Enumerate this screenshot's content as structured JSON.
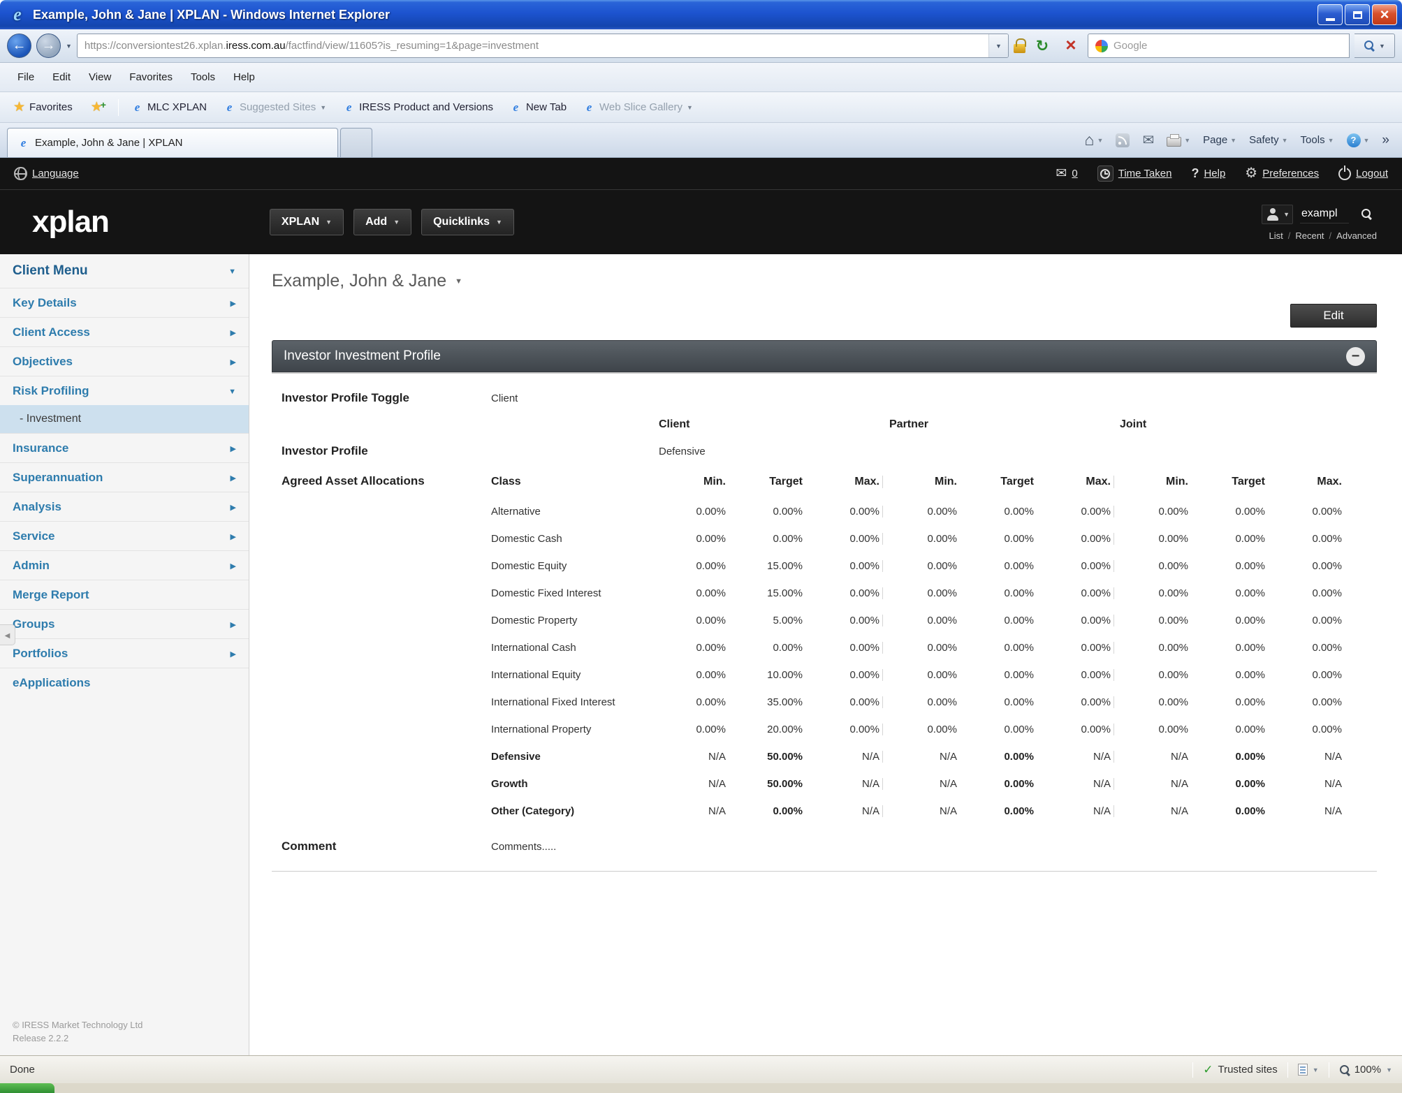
{
  "window": {
    "title": "Example, John & Jane | XPLAN - Windows Internet Explorer"
  },
  "browser": {
    "url_prefix": "https://conversiontest26.xplan.",
    "url_domain": "iress.com.au",
    "url_suffix": "/factfind/view/11605?is_resuming=1&page=investment",
    "search_placeholder": "Google",
    "menu": [
      "File",
      "Edit",
      "View",
      "Favorites",
      "Tools",
      "Help"
    ],
    "favorites_label": "Favorites",
    "favorites_items": [
      {
        "label": "MLC XPLAN",
        "muted": false,
        "caret": false
      },
      {
        "label": "Suggested Sites",
        "muted": true,
        "caret": true
      },
      {
        "label": "IRESS Product and Versions",
        "muted": false,
        "caret": false
      },
      {
        "label": "New Tab",
        "muted": false,
        "caret": false
      },
      {
        "label": "Web Slice Gallery",
        "muted": true,
        "caret": true
      }
    ],
    "tab_title": "Example, John & Jane | XPLAN",
    "command_items": [
      {
        "label": "Page"
      },
      {
        "label": "Safety"
      },
      {
        "label": "Tools"
      }
    ],
    "status": {
      "done": "Done",
      "zone": "Trusted sites",
      "zoom": "100%"
    }
  },
  "app": {
    "topbar": {
      "language": "Language",
      "mail_count": "0",
      "time_taken": "Time Taken",
      "help": "Help",
      "preferences": "Preferences",
      "logout": "Logout"
    },
    "header": {
      "logo": "xplan",
      "nav": [
        "XPLAN",
        "Add",
        "Quicklinks"
      ],
      "search_value": "exampl",
      "search_links": [
        "List",
        "Recent",
        "Advanced"
      ],
      "search_links_sep": "/"
    }
  },
  "sidebar": {
    "items": [
      {
        "label": "Client Menu",
        "arrow": "down",
        "header": true
      },
      {
        "label": "Key Details",
        "arrow": "right"
      },
      {
        "label": "Client Access",
        "arrow": "right"
      },
      {
        "label": "Objectives",
        "arrow": "right"
      },
      {
        "label": "Risk Profiling",
        "arrow": "down"
      },
      {
        "label": "Investment",
        "sub": true,
        "active": true
      },
      {
        "label": "Insurance",
        "arrow": "right"
      },
      {
        "label": "Superannuation",
        "arrow": "right"
      },
      {
        "label": "Analysis",
        "arrow": "right"
      },
      {
        "label": "Service",
        "arrow": "right"
      },
      {
        "label": "Admin",
        "arrow": "right"
      },
      {
        "label": "Merge Report"
      },
      {
        "label": "Groups",
        "arrow": "right"
      },
      {
        "label": "Portfolios",
        "arrow": "right"
      },
      {
        "label": "eApplications"
      }
    ],
    "footer_line1": "© IRESS Market Technology Ltd",
    "footer_line2": "Release 2.2.2"
  },
  "main": {
    "breadcrumb": "Example, John & Jane",
    "edit_button": "Edit",
    "panel_title": "Investor Investment Profile",
    "labels": {
      "toggle": "Investor Profile Toggle",
      "profile": "Investor Profile",
      "allocations": "Agreed Asset Allocations",
      "comment": "Comment"
    },
    "values": {
      "toggle": "Client",
      "profile": "Defensive",
      "comment": "Comments....."
    },
    "groups": [
      "Client",
      "Partner",
      "Joint"
    ],
    "table": {
      "class_header": "Class",
      "col_headers": [
        "Min.",
        "Target",
        "Max."
      ],
      "rows": [
        {
          "label": "Alternative",
          "bold": false,
          "values": [
            "0.00%",
            "0.00%",
            "0.00%",
            "0.00%",
            "0.00%",
            "0.00%",
            "0.00%",
            "0.00%",
            "0.00%"
          ]
        },
        {
          "label": "Domestic Cash",
          "bold": false,
          "values": [
            "0.00%",
            "0.00%",
            "0.00%",
            "0.00%",
            "0.00%",
            "0.00%",
            "0.00%",
            "0.00%",
            "0.00%"
          ]
        },
        {
          "label": "Domestic Equity",
          "bold": false,
          "values": [
            "0.00%",
            "15.00%",
            "0.00%",
            "0.00%",
            "0.00%",
            "0.00%",
            "0.00%",
            "0.00%",
            "0.00%"
          ]
        },
        {
          "label": "Domestic Fixed Interest",
          "bold": false,
          "values": [
            "0.00%",
            "15.00%",
            "0.00%",
            "0.00%",
            "0.00%",
            "0.00%",
            "0.00%",
            "0.00%",
            "0.00%"
          ]
        },
        {
          "label": "Domestic Property",
          "bold": false,
          "values": [
            "0.00%",
            "5.00%",
            "0.00%",
            "0.00%",
            "0.00%",
            "0.00%",
            "0.00%",
            "0.00%",
            "0.00%"
          ]
        },
        {
          "label": "International Cash",
          "bold": false,
          "values": [
            "0.00%",
            "0.00%",
            "0.00%",
            "0.00%",
            "0.00%",
            "0.00%",
            "0.00%",
            "0.00%",
            "0.00%"
          ]
        },
        {
          "label": "International Equity",
          "bold": false,
          "values": [
            "0.00%",
            "10.00%",
            "0.00%",
            "0.00%",
            "0.00%",
            "0.00%",
            "0.00%",
            "0.00%",
            "0.00%"
          ]
        },
        {
          "label": "International Fixed Interest",
          "bold": false,
          "values": [
            "0.00%",
            "35.00%",
            "0.00%",
            "0.00%",
            "0.00%",
            "0.00%",
            "0.00%",
            "0.00%",
            "0.00%"
          ]
        },
        {
          "label": "International Property",
          "bold": false,
          "values": [
            "0.00%",
            "20.00%",
            "0.00%",
            "0.00%",
            "0.00%",
            "0.00%",
            "0.00%",
            "0.00%",
            "0.00%"
          ]
        },
        {
          "label": "Defensive",
          "bold": true,
          "values": [
            "N/A",
            "50.00%",
            "N/A",
            "N/A",
            "0.00%",
            "N/A",
            "N/A",
            "0.00%",
            "N/A"
          ]
        },
        {
          "label": "Growth",
          "bold": true,
          "values": [
            "N/A",
            "50.00%",
            "N/A",
            "N/A",
            "0.00%",
            "N/A",
            "N/A",
            "0.00%",
            "N/A"
          ]
        },
        {
          "label": "Other (Category)",
          "bold": true,
          "values": [
            "N/A",
            "0.00%",
            "N/A",
            "N/A",
            "0.00%",
            "N/A",
            "N/A",
            "0.00%",
            "N/A"
          ]
        }
      ]
    }
  },
  "colors": {
    "titlebar_blue": "#1c53cf",
    "app_black": "#141414",
    "sidebar_link_blue": "#2e7cad",
    "selected_item_bg": "#cde0ee",
    "panel_header_gray": "#464c52",
    "status_green": "#2e9c2e",
    "start_button_green": "#2f8f32"
  }
}
